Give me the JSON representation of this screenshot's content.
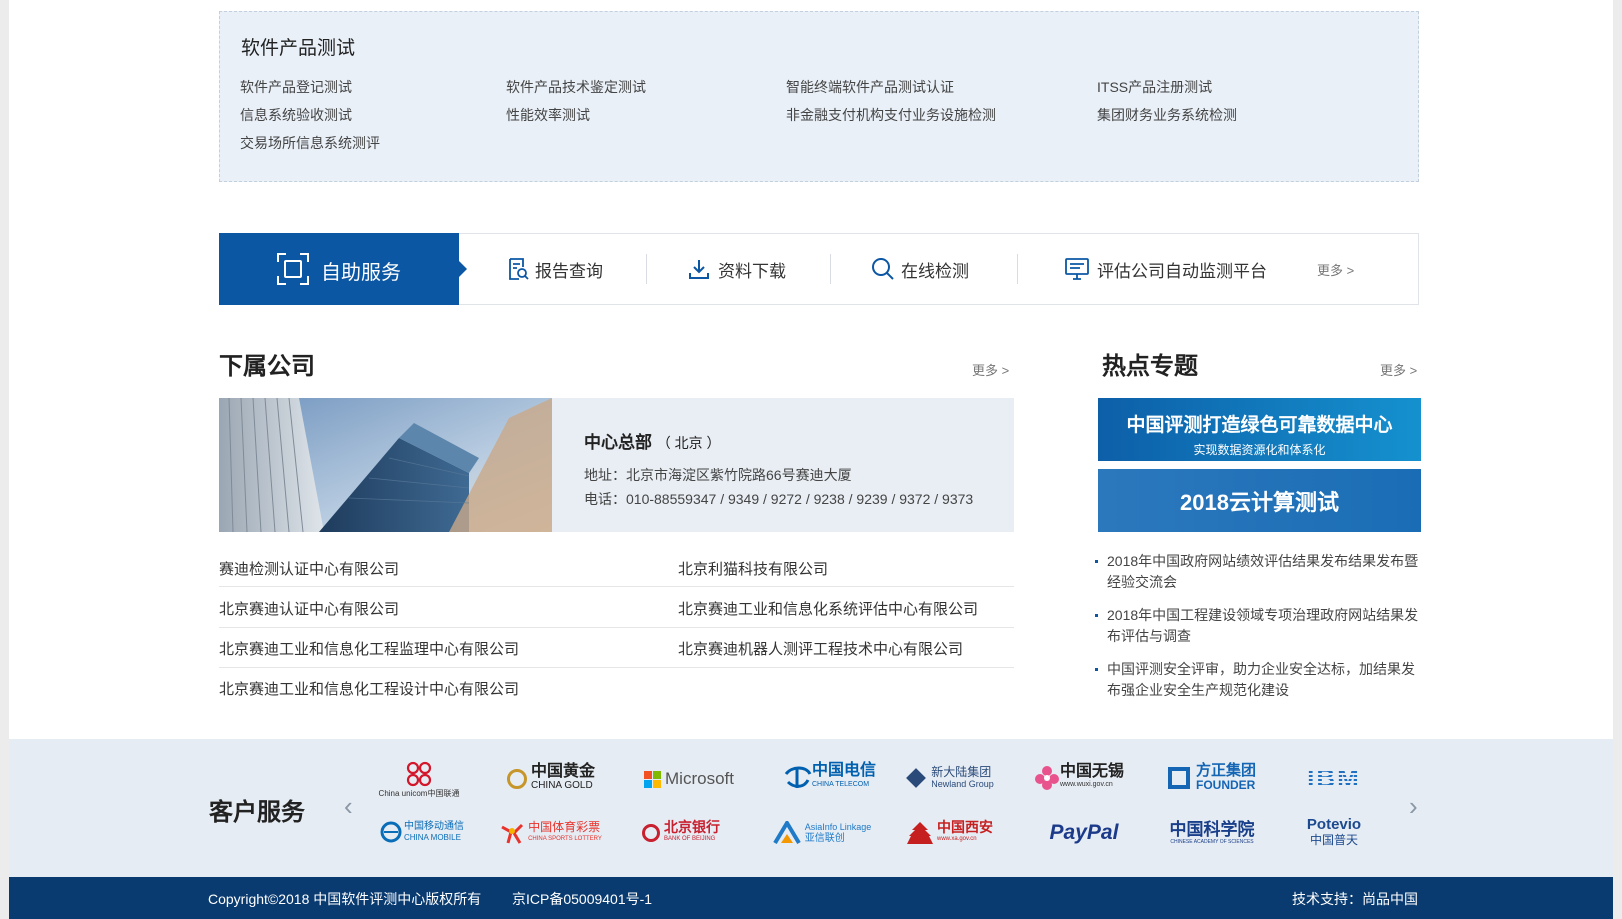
{
  "software_products": {
    "title": "软件产品测试",
    "items": [
      "软件产品登记测试",
      "软件产品技术鉴定测试",
      "智能终端软件产品测试认证",
      "ITSS产品注册测试",
      "信息系统验收测试",
      "性能效率测试",
      "非金融支付机构支付业务设施检测",
      "集团财务业务系统检测",
      "交易场所信息系统测评"
    ]
  },
  "services": {
    "active": "自助服务",
    "items": [
      "报告查询",
      "资料下载",
      "在线检测",
      "评估公司自动监测平台"
    ],
    "more": "更多 >"
  },
  "subsidiaries": {
    "title": "下属公司",
    "more": "更多 >",
    "hq_name": "中心总部",
    "hq_city": "（ 北京 ）",
    "hq_address": "地址：北京市海淀区紫竹院路66号赛迪大厦",
    "hq_phone": "电话：010-88559347 / 9349 / 9272 / 9238 / 9239 / 9372 / 9373",
    "companies": [
      "赛迪检测认证中心有限公司",
      "北京利猫科技有限公司",
      "北京赛迪认证中心有限公司",
      "北京赛迪工业和信息化系统评估中心有限公司",
      "北京赛迪工业和信息化工程监理中心有限公司",
      "北京赛迪机器人测评工程技术中心有限公司",
      "北京赛迪工业和信息化工程设计中心有限公司"
    ]
  },
  "hot_topics": {
    "title": "热点专题",
    "more": "更多 >",
    "banner1_title": "中国评测打造绿色可靠数据中心",
    "banner1_sub": "实现数据资源化和体系化",
    "banner2_title": "2018云计算测试",
    "news": [
      "2018年中国政府网站绩效评估结果发布结果发布暨经验交流会",
      "2018年中国工程建设领域专项治理政府网站结果发布评估与调查",
      "中国评测安全评审，助力企业安全达标，加结果发布强企业安全生产规范化建设"
    ]
  },
  "customers": {
    "title": "客户服务",
    "prev": "‹",
    "next": "›",
    "logos_row1": [
      "中国联通",
      "中国黄金",
      "Microsoft",
      "中国电信",
      "新大陆集团",
      "中国无锡",
      "方正集团",
      "IBM"
    ],
    "logos_row2": [
      "中国移动通信",
      "中国体育彩票",
      "北京银行",
      "亚信联创",
      "中国西安",
      "PayPal",
      "中国科学院",
      "中国普天"
    ],
    "sublabels": {
      "unicom_en": "China unicom中国联通",
      "gold_en": "CHINA GOLD",
      "telecom_en": "CHINA TELECOM",
      "newland_en": "Newland Group",
      "wuxi_en": "www.wuxi.gov.cn",
      "founder_en": "FOUNDER",
      "mobile_en": "CHINA MOBILE",
      "lottery_en": "CHINA SPORTS LOTTERY",
      "bob_en": "BANK OF BEIJING",
      "asiainfo_en": "AsiaInfo Linkage",
      "xian_en": "www.xa.gov.cn",
      "cas_en": "CHINESE ACADEMY OF SCIENCES",
      "potevio_en": "Potevio"
    }
  },
  "footer": {
    "copyright": "Copyright©2018 中国软件评测中心版权所有",
    "icp": "京ICP备05009401号-1",
    "support": "技术支持：尚品中国"
  },
  "colors": {
    "primary": "#0b57a4",
    "footer": "#0a3b70",
    "light_bg": "#e9f0f8"
  }
}
